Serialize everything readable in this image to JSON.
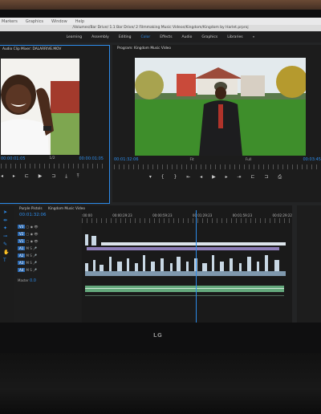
{
  "menu": {
    "items": [
      "Markers",
      "Graphics",
      "Window",
      "Help"
    ]
  },
  "title_bar": {
    "text": "/Volumes/Bar Drive/ 1.1 Bar Drive/ 2 Filmmaking Music Videos/Kingdom/Kingdom by Harlet.prproj"
  },
  "workspaces": {
    "items": [
      "Learning",
      "Assembly",
      "Editing",
      "Color",
      "Effects",
      "Audio",
      "Graphics",
      "Libraries",
      "»"
    ],
    "active_index": 3
  },
  "source_monitor": {
    "title": "Audio Clip Mixer: DALARRIVE.MOV",
    "fit": "1/2",
    "timecode": "00:00:01:05"
  },
  "program_monitor": {
    "title": "Program: Kingdom Music Video",
    "current_timecode": "00:01:32:06",
    "fit": "Fit",
    "quality": "Full",
    "duration": "00:03:45"
  },
  "project_panel": {
    "tab": "Purple Pistols"
  },
  "timeline": {
    "tab": "Kingdom Music Video",
    "timecode": "00:01:32:06",
    "ruler_labels": [
      ":00:00",
      "00:00:29:23",
      "00:00:59:23",
      "00:01:29:23",
      "00:01:59:23",
      "00:02:29:22"
    ],
    "master_label": "Master",
    "master_value": "0.0",
    "tracks": [
      "V3",
      "V2",
      "V1",
      "A1",
      "A2",
      "A3",
      "A4"
    ]
  },
  "monitor_brand": {
    "label": "LG"
  },
  "colors": {
    "accent": "#2d8ceb",
    "audio_clip": "#64a87c",
    "video_clip": "#c9d8e4"
  }
}
